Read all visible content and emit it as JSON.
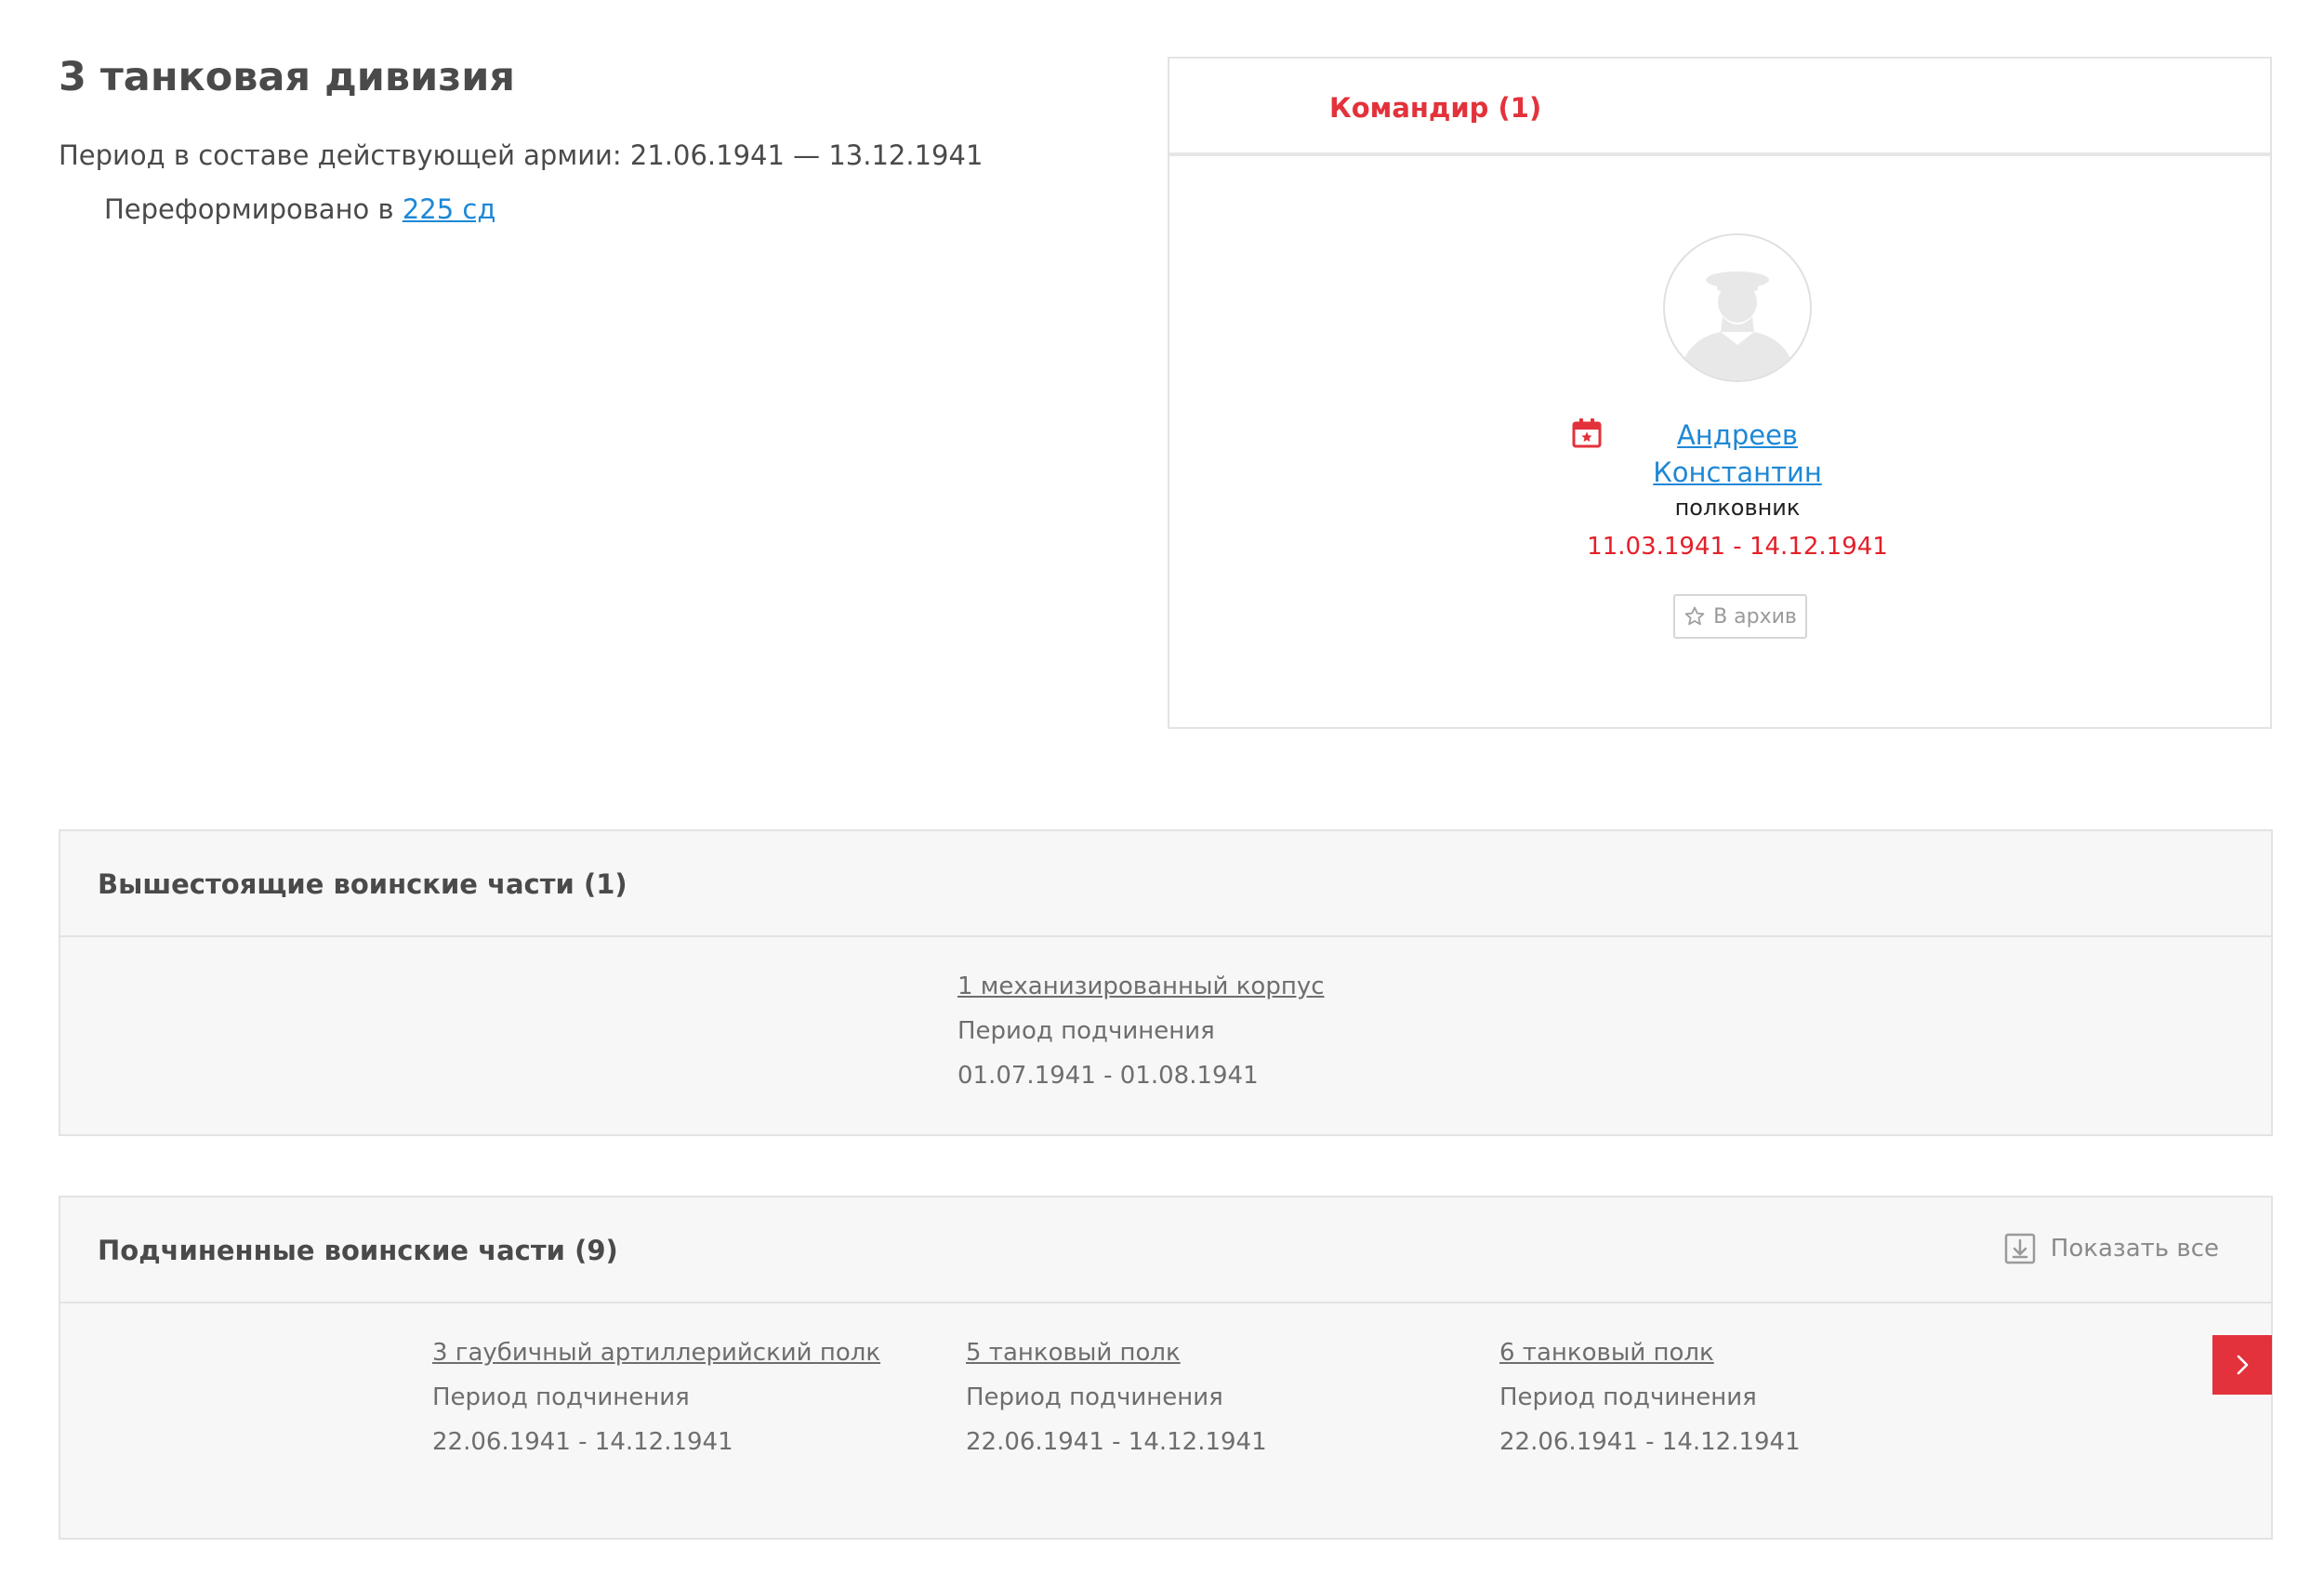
{
  "unit": {
    "title": "3 танковая дивизия",
    "period_text": "Период в составе действующей армии: 21.06.1941 — 13.12.1941",
    "reformed_prefix": "Переформировано в ",
    "reformed_link": "225 сд"
  },
  "commanders": {
    "tab_label": "Командир (1)",
    "items": [
      {
        "name_line1": "Андреев",
        "name_line2": "Константин",
        "rank": "полковник",
        "dates": "11.03.1941 - 14.12.1941",
        "archive_label": "В архив"
      }
    ]
  },
  "superior": {
    "title": "Вышестоящие воинские части (1)",
    "items": [
      {
        "name": "1 механизированный корпус",
        "period_label": "Период подчинения",
        "dates": "01.07.1941 - 01.08.1941"
      }
    ]
  },
  "subordinate": {
    "title": "Подчиненные воинские части (9)",
    "show_all": "Показать все",
    "items": [
      {
        "name": "3 гаубичный артиллерийский полк",
        "period_label": "Период подчинения",
        "dates": "22.06.1941 - 14.12.1941"
      },
      {
        "name": "5 танковый полк",
        "period_label": "Период подчинения",
        "dates": "22.06.1941 - 14.12.1941"
      },
      {
        "name": "6 танковый полк",
        "period_label": "Период подчинения",
        "dates": "22.06.1941 - 14.12.1941"
      }
    ]
  },
  "icons": {
    "calendar": "calendar-star-icon",
    "archive": "star-outline-icon",
    "show_all": "download-box-icon",
    "next": "chevron-right-icon",
    "avatar": "soldier-silhouette-icon"
  },
  "colors": {
    "accent": "#e3323b",
    "link": "#1e88d6",
    "panel_bg": "#f7f7f7"
  }
}
